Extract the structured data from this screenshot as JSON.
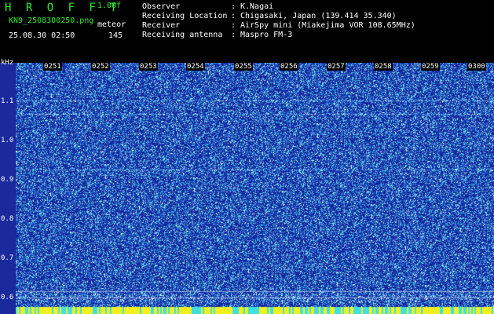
{
  "header": {
    "brand": "H R O F F T",
    "version": "1.00f",
    "file_name": "KN9_2508300250.png",
    "timestamp": "25.08.30 02:50",
    "meteor_label": "meteor",
    "meteor_count": "145",
    "info": [
      {
        "key": "Observer",
        "value": "K.Nagai"
      },
      {
        "key": "Receiving Location",
        "value": "Chigasaki, Japan (139.414 35.340)"
      },
      {
        "key": "Receiver",
        "value": "AirSpy mini (Miakejima VOR 108.65MHz)"
      },
      {
        "key": "Receiving antenna",
        "value": "Maspro FM-3"
      }
    ],
    "info_sep": ":"
  },
  "spectrogram": {
    "unit": "kHz",
    "freq_ticks": [
      "1.1",
      "1.0",
      "0.9",
      "0.8",
      "0.7",
      "0.6"
    ],
    "time_ticks": [
      "0251",
      "0252",
      "0253",
      "0254",
      "0255",
      "0256",
      "0257",
      "0258",
      "0259",
      "0300"
    ]
  },
  "colors": {
    "text_green": "#2ee82e",
    "background_blue": "#1a2a9c",
    "noise_cyan": "#40e0e0",
    "bottom_band_yellow": "#f0f020"
  }
}
